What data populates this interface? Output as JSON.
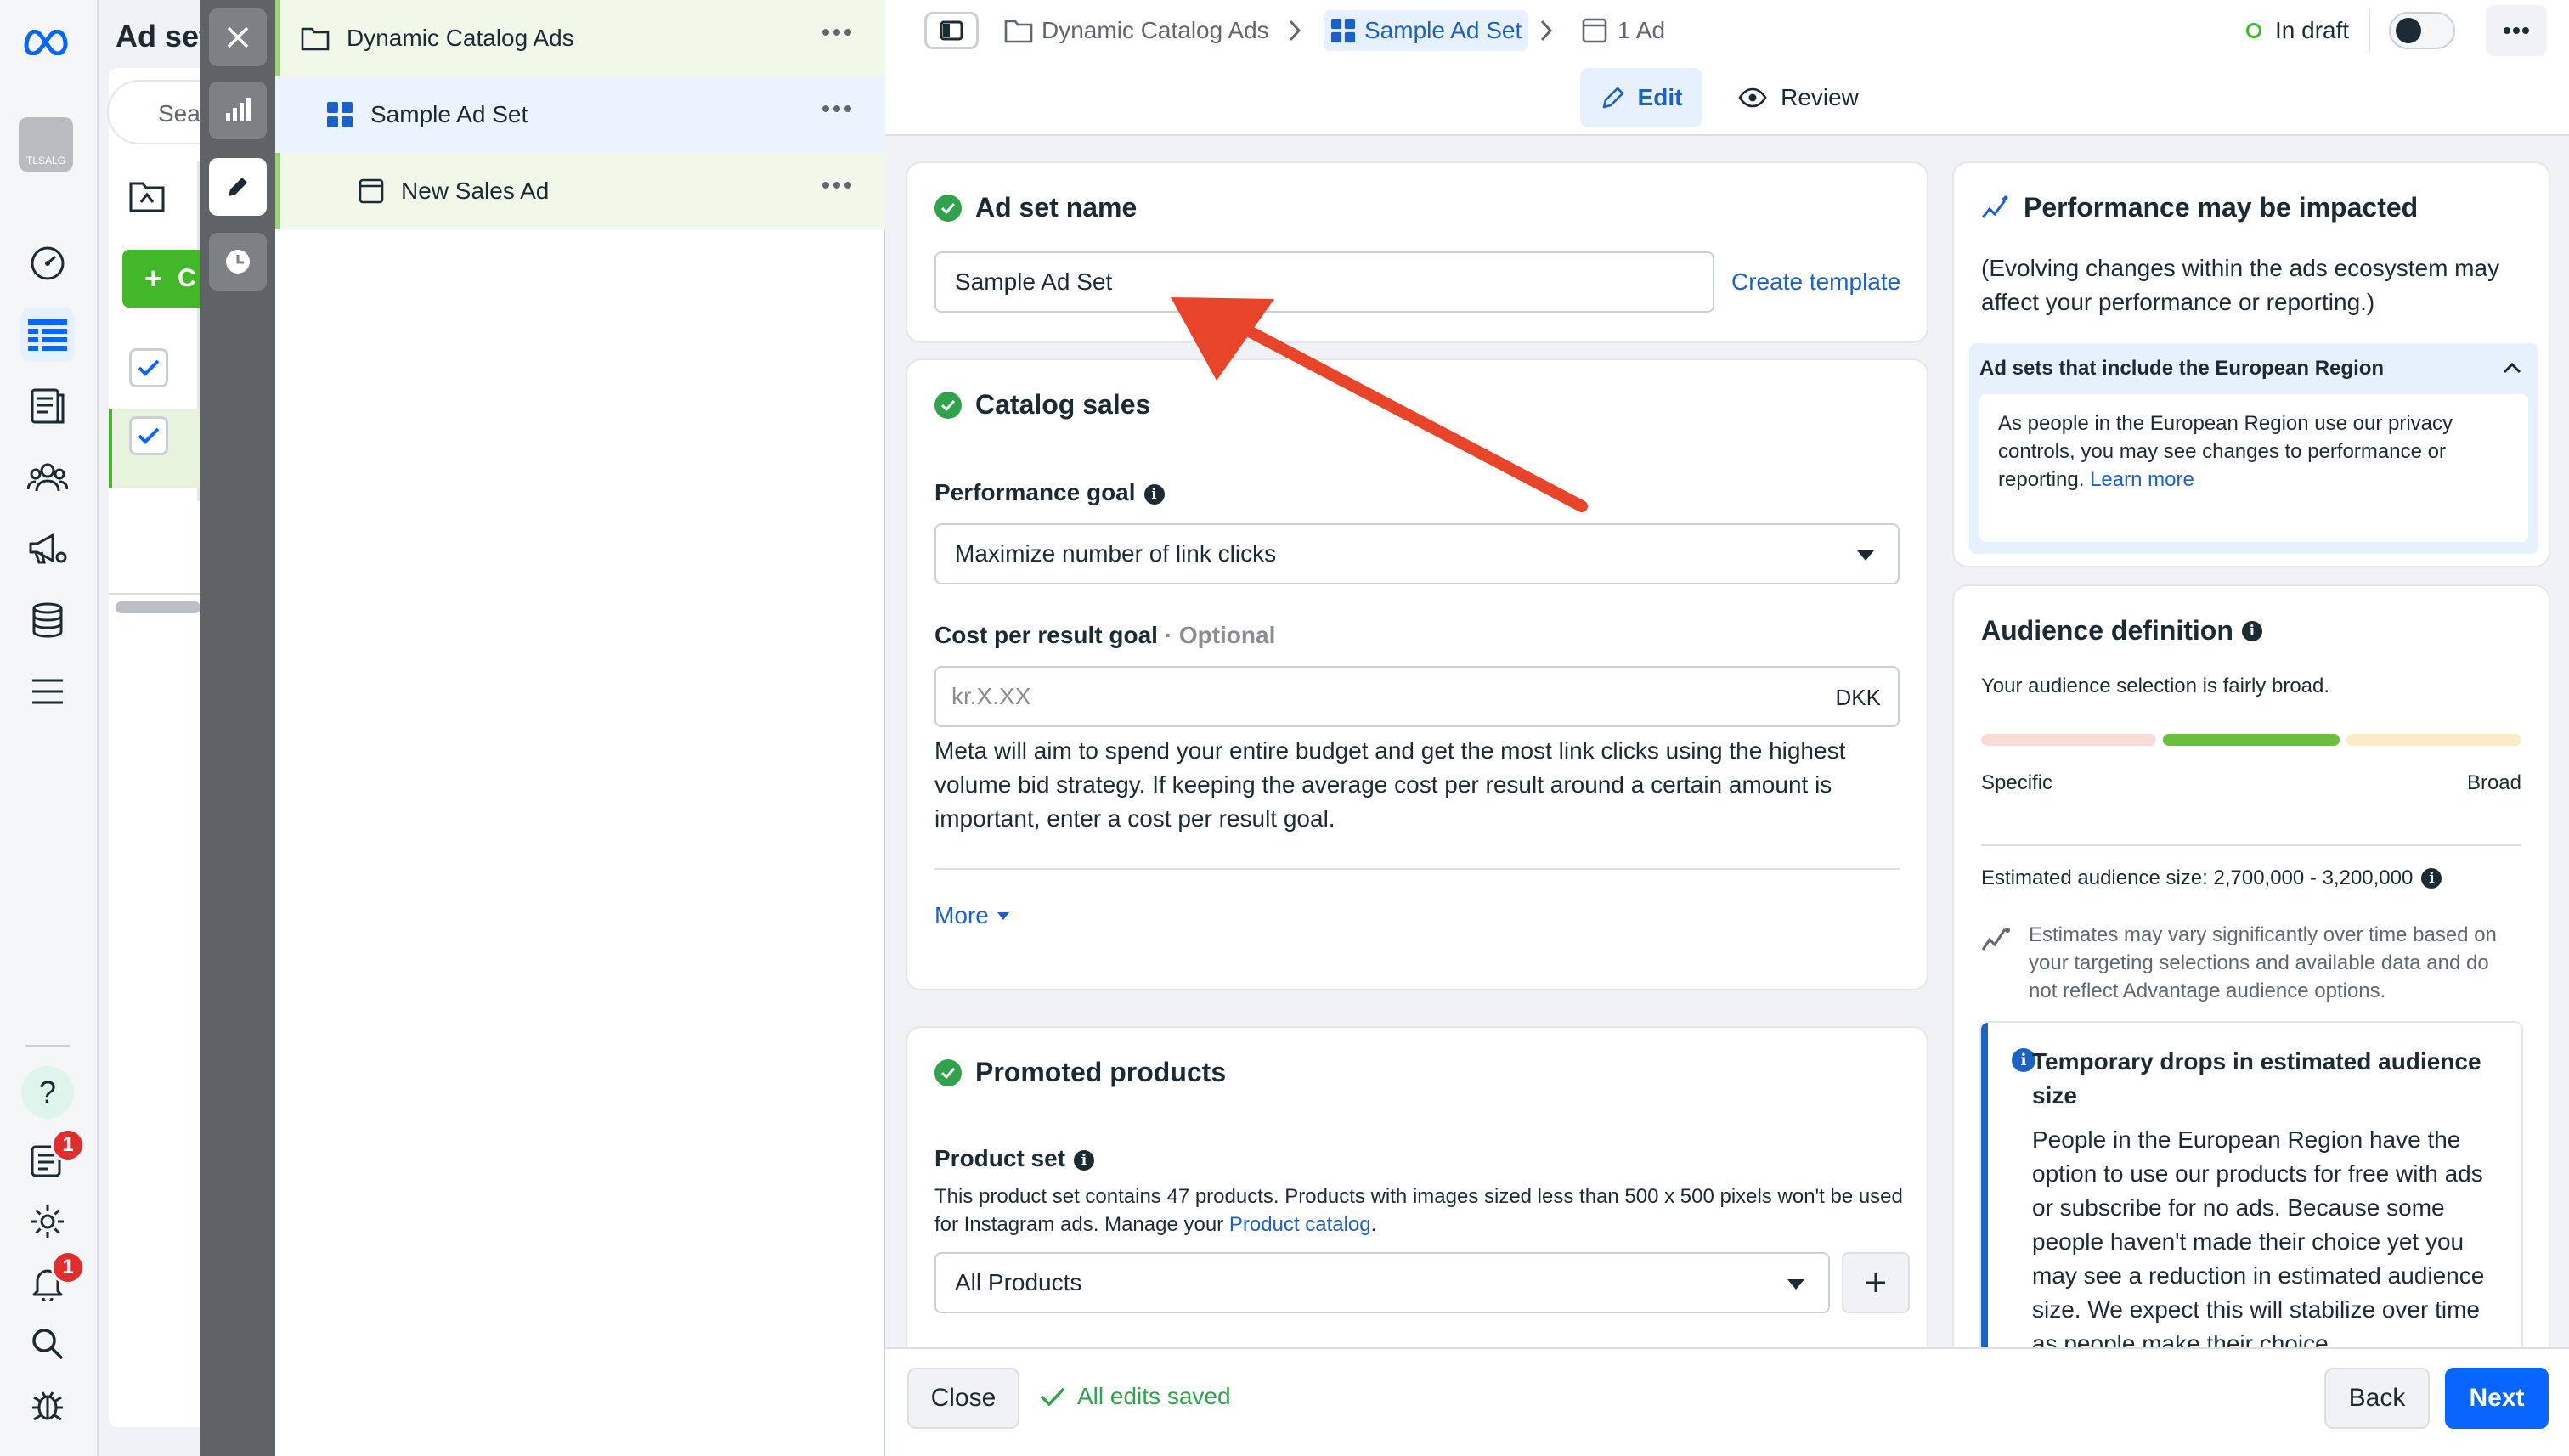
{
  "left_nav": {
    "badges": {
      "notifications_a": "1",
      "notifications_b": "1"
    },
    "avatar_text": "TLSALG"
  },
  "background": {
    "title": "Ad set",
    "search_placeholder": "Sea",
    "create_label": "C"
  },
  "tree": {
    "campaign": "Dynamic Catalog Ads",
    "adset": "Sample Ad Set",
    "ad": "New Sales Ad"
  },
  "topbar": {
    "crumbs": [
      "Dynamic Catalog Ads",
      "Sample Ad Set",
      "1 Ad"
    ],
    "status": "In draft",
    "edit_label": "Edit",
    "review_label": "Review"
  },
  "adset_name": {
    "title": "Ad set name",
    "value": "Sample Ad Set",
    "create_template": "Create template"
  },
  "catalog_sales": {
    "title": "Catalog sales",
    "performance_goal_label": "Performance goal",
    "performance_goal_value": "Maximize number of link clicks",
    "cost_label": "Cost per result goal",
    "cost_optional": "· Optional",
    "cost_placeholder": "kr.X.XX",
    "currency": "DKK",
    "description": "Meta will aim to spend your entire budget and get the most link clicks using the highest volume bid strategy. If keeping the average cost per result around a certain amount is important, enter a cost per result goal.",
    "more_label": "More"
  },
  "promoted_products": {
    "title": "Promoted products",
    "product_set_label": "Product set",
    "description_prefix": "This product set contains 47 products. Products with images sized less than 500 x 500 pixels won't be used for Instagram ads. Manage your ",
    "description_link": "Product catalog",
    "description_suffix": ".",
    "product_set_value": "All Products"
  },
  "performance_card": {
    "title": "Performance may be impacted",
    "subtitle": "(Evolving changes within the ads ecosystem may affect your performance or reporting.)",
    "accordion_title": "Ad sets that include the European Region",
    "accordion_body": "As people in the European Region use our privacy controls, you may see changes to performance or reporting. ",
    "learn_more": "Learn more"
  },
  "audience_card": {
    "title": "Audience definition",
    "breadth_text": "Your audience selection is fairly broad.",
    "specific_label": "Specific",
    "broad_label": "Broad",
    "breadth_level_segment": 2,
    "estimated_label": "Estimated audience size: 2,700,000 - 3,200,000",
    "estimate_note": "Estimates may vary significantly over time based on your targeting selections and available data and do not reflect Advantage audience options.",
    "drop_title": "Temporary drops in estimated audience size",
    "drop_body": "People in the European Region have the option to use our products for free with ads or subscribe for no ads. Because some people haven't made their choice yet you may see a reduction in estimated audience size. We expect this will stabilize over time as people make their choice."
  },
  "bottombar": {
    "close_label": "Close",
    "saved_label": "All edits saved",
    "back_label": "Back",
    "next_label": "Next"
  },
  "colors": {
    "accent": "#0866ff",
    "success": "#31a24c",
    "annotation_arrow": "#e8442a"
  }
}
